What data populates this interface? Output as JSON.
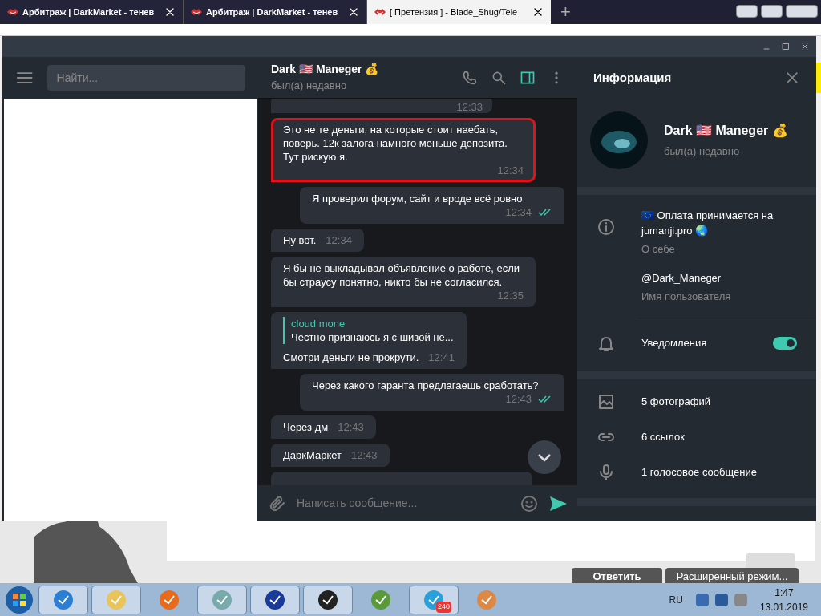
{
  "browser": {
    "tabs": [
      {
        "title": "Арбитраж | DarkMarket - тенев",
        "selected": false
      },
      {
        "title": "Арбитраж | DarkMarket - тенев",
        "selected": false
      },
      {
        "title": "[ Претензия ] - Blade_Shug/Tele",
        "selected": true
      }
    ],
    "new_tab": "+",
    "page_buttons": [
      "Ответить",
      "Расширенный режим..."
    ]
  },
  "telegram": {
    "search": {
      "placeholder": "Найти..."
    },
    "chat": {
      "name": "Dark 🇺🇸 Maneger 💰",
      "status": "был(а) недавно",
      "messages": [
        {
          "kind": "cut_top",
          "outgoing": false,
          "time": "12:33"
        },
        {
          "kind": "text",
          "outgoing": false,
          "highlighted": true,
          "text": "Это не те деньги, на которые стоит наебать, поверь. 12к залога намного меньше депозита. Тут рискую я.",
          "time": "12:34",
          "read": false
        },
        {
          "kind": "text",
          "outgoing": true,
          "highlighted": false,
          "text": "Я проверил форум, сайт и вроде всё ровно",
          "time": "12:34",
          "read": true
        },
        {
          "kind": "text",
          "outgoing": false,
          "highlighted": false,
          "text": "Ну вот.",
          "time": "12:34",
          "read": false
        },
        {
          "kind": "text",
          "outgoing": false,
          "highlighted": false,
          "text": "Я бы не выкладывал объявление о работе, если бы страусу понятно, никто бы не согласился.",
          "time": "12:35",
          "read": false
        },
        {
          "kind": "reply",
          "outgoing": false,
          "highlighted": false,
          "reply_author": "cloud mone",
          "reply_text": "Честно признаюсь я с шизой не...",
          "text": "Смотри деньги не прокрути.",
          "time": "12:41",
          "read": false
        },
        {
          "kind": "text",
          "outgoing": true,
          "highlighted": false,
          "text": "Через какого гаранта предлагаешь сработать?",
          "time": "12:43",
          "read": true
        },
        {
          "kind": "text",
          "outgoing": false,
          "highlighted": false,
          "text": "Через дм",
          "time": "12:43",
          "read": false
        },
        {
          "kind": "text",
          "outgoing": false,
          "highlighted": false,
          "text": "ДаркМаркет",
          "time": "12:43",
          "read": false
        },
        {
          "kind": "cut_bottom",
          "outgoing": false
        }
      ],
      "composer": {
        "placeholder": "Написать сообщение..."
      }
    },
    "info": {
      "title": "Информация",
      "name": "Dark 🇺🇸 Maneger 💰",
      "status": "был(а) недавно",
      "bio": "🇪🇺 Оплата принимается на jumanji.pro 🌏",
      "bio_label": "О себе",
      "username": "@Dark_Maneger",
      "username_label": "Имя пользователя",
      "notifications": {
        "label": "Уведомления",
        "on": true
      },
      "media": [
        {
          "label": "5 фотографий"
        },
        {
          "kind": "link",
          "label": "6 ссылок"
        },
        {
          "kind": "voice",
          "label": "1 голосовое сообщение"
        }
      ]
    }
  },
  "taskbar": {
    "language": "RU",
    "time": "1:47",
    "date": "13.01.2019",
    "telegram_badge": "240"
  }
}
